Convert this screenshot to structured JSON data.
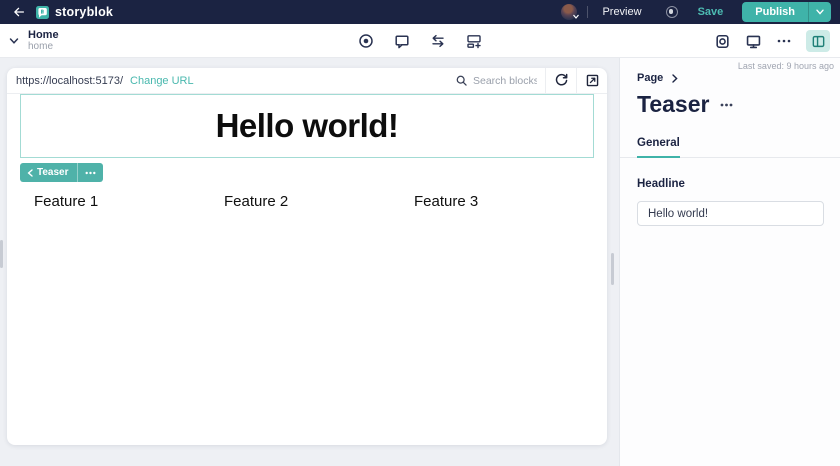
{
  "colors": {
    "brand_teal": "#3fb3a9",
    "dark_navy": "#1b2342",
    "selection_teal": "#a3dbd4"
  },
  "topbar": {
    "logo_text": "storyblok",
    "preview_label": "Preview",
    "save_label": "Save",
    "publish_label": "Publish"
  },
  "story_bar": {
    "title": "Home",
    "slug": "home"
  },
  "canvas": {
    "url": "https://localhost:5173/",
    "change_url_label": "Change URL",
    "search_placeholder": "Search blocks...",
    "heading": "Hello world!",
    "selected_block": "Teaser",
    "features": [
      "Feature 1",
      "Feature 2",
      "Feature 3"
    ]
  },
  "sidebar": {
    "last_saved": "Last saved: 9 hours ago",
    "breadcrumb": "Page",
    "title": "Teaser",
    "tabs": [
      {
        "label": "General"
      }
    ],
    "fields": [
      {
        "label": "Headline",
        "value": "Hello world!"
      }
    ]
  }
}
